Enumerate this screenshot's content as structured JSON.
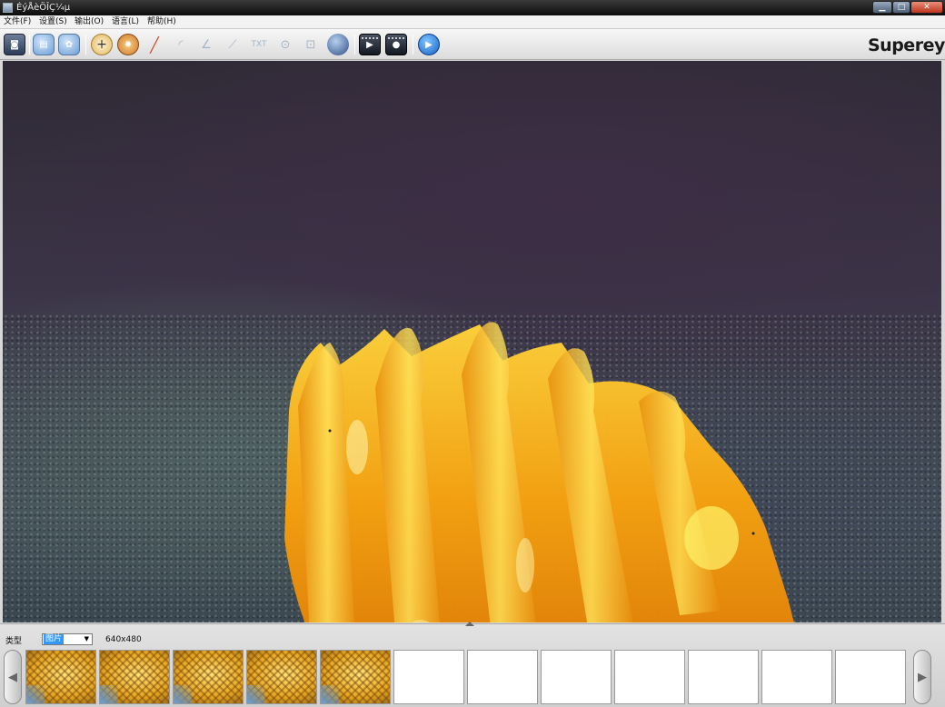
{
  "window": {
    "title": "ÉýÅèÖÎÇ¼µ"
  },
  "menu": [
    {
      "label": "文件(F)"
    },
    {
      "label": "设置(S)"
    },
    {
      "label": "输出(O)"
    },
    {
      "label": "语言(L)"
    },
    {
      "label": "帮助(H)"
    }
  ],
  "toolbar": {
    "icons": [
      "camera-icon",
      "folder-open-icon",
      "video-settings-icon",
      "crosshair-icon",
      "gear-icon",
      "ruler-icon",
      "arc-icon",
      "angle-icon",
      "line-icon",
      "text-icon",
      "circle-icon",
      "rectangle-icon",
      "sphere-icon",
      "film-icon",
      "film-record-icon",
      "play-icon"
    ],
    "text_tool_label": "TXT",
    "logo": "Supereyes"
  },
  "bottom_panel": {
    "type_label": "类型",
    "type_value": "图片",
    "resolution": "640x480",
    "thumbnails_filled": 5,
    "thumbnails_total": 12
  }
}
